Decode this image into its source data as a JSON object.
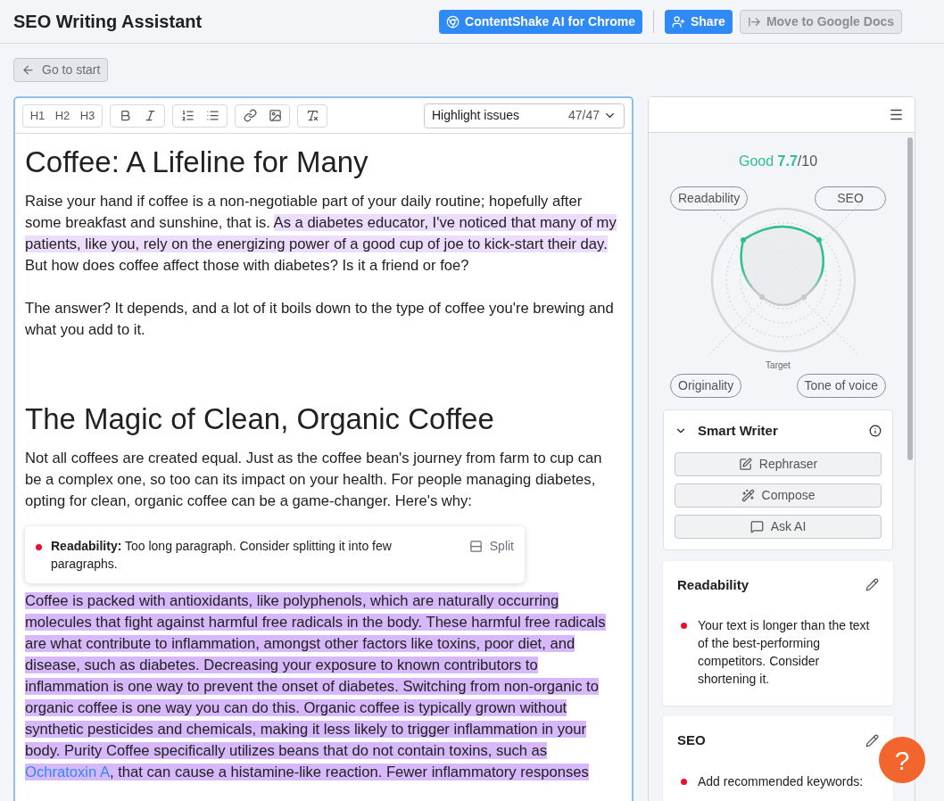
{
  "header": {
    "title": "SEO Writing Assistant",
    "buttons": [
      {
        "label": "ContentShake AI for Chrome",
        "kind": "chrome"
      },
      {
        "label": "Share",
        "kind": "share"
      },
      {
        "label": "Move to Google Docs",
        "kind": "docs"
      }
    ]
  },
  "back_button": "Go to start",
  "toolbar": {
    "groups": [
      [
        {
          "kind": "heading",
          "label": "H1"
        },
        {
          "kind": "heading",
          "label": "H2"
        },
        {
          "kind": "heading",
          "label": "H3"
        }
      ],
      [
        {
          "kind": "bold"
        },
        {
          "kind": "italic"
        }
      ],
      [
        {
          "kind": "ordered-list"
        },
        {
          "kind": "bullet-list"
        }
      ],
      [
        {
          "kind": "link"
        },
        {
          "kind": "image"
        }
      ],
      [
        {
          "kind": "clear-format"
        }
      ]
    ],
    "highlight_select": {
      "value": "Highlight issues",
      "count": "47/47"
    }
  },
  "document": [
    {
      "kind": "h1",
      "text": "Coffee: A Lifeline for Many"
    },
    {
      "kind": "p",
      "segments": [
        {
          "text": "Raise your hand if coffee is a non-negotiable part of your daily routine; hopefully after some breakfast and sunshine, that is. ",
          "kind": "plain"
        },
        {
          "text": "As a diabetes educator, I've noticed that many of my patients, like you, rely on the energizing power of a good cup of joe to kick-start their day.",
          "kind": "light"
        },
        {
          "text": " But how does coffee affect those with diabetes? Is it a friend or foe?",
          "kind": "plain"
        }
      ]
    },
    {
      "kind": "p",
      "segments": [
        {
          "text": "The answer? It depends, and a lot of it boils down to the type of coffee you're brewing and what you add to it.",
          "kind": "plain"
        }
      ]
    },
    {
      "kind": "h1",
      "text": "The Magic of Clean, Organic Coffee"
    },
    {
      "kind": "p",
      "segments": [
        {
          "text": "Not all coffees are created equal. Just as the coffee bean's journey from farm to cup can be a complex one, so too can its impact on your health. For people managing diabetes, opting for clean, organic coffee can be a game-changer. Here's why:",
          "kind": "plain"
        }
      ]
    },
    {
      "kind": "issue",
      "label": "Readability:",
      "text": "Too long paragraph. Consider splitting it into few paragraphs.",
      "action": "Split"
    },
    {
      "kind": "p",
      "segments": [
        {
          "text": "Coffee is packed with antioxidants, like polyphenols, which are naturally occurring molecules that fight against harmful free radicals in the body. These harmful free radicals are what contribute to inflammation, amongst other factors like toxins, poor diet, and disease, such as diabetes. Decreasing your exposure to known contributors to inflammation is one way to prevent the onset of diabetes. Switching from non-organic to organic coffee is one way you can do this. Organic coffee is typically grown without synthetic pesticides and chemicals, making it less likely to trigger inflammation in your body. Purity Coffee specifically utilizes beans that do not contain toxins, such as ",
          "kind": "strong"
        },
        {
          "text": "Ochratoxin A",
          "kind": "strong_link"
        },
        {
          "text": ", that can cause a histamine-like reaction. Fewer inflammatory responses",
          "kind": "strong"
        }
      ]
    }
  ],
  "score": {
    "rating": "Good",
    "value": "7.7",
    "max": "/10",
    "labels": [
      "Readability",
      "SEO",
      "Originality",
      "Tone of voice"
    ],
    "target": "Target"
  },
  "smart_writer": {
    "title": "Smart Writer",
    "expanded": true,
    "buttons": [
      {
        "label": "Rephraser",
        "kind": "rephrase"
      },
      {
        "label": "Compose",
        "kind": "compose"
      },
      {
        "label": "Ask AI",
        "kind": "ask"
      }
    ]
  },
  "cards": [
    {
      "title": "Readability",
      "items": [
        {
          "text": "Your text is longer than the text of the best-performing competitors. Consider shortening it.",
          "color": "#e8112d"
        }
      ]
    },
    {
      "title": "SEO",
      "items": [
        {
          "text": "Add recommended keywords:",
          "color": "#e8112d"
        }
      ]
    }
  ],
  "help_button": "?"
}
